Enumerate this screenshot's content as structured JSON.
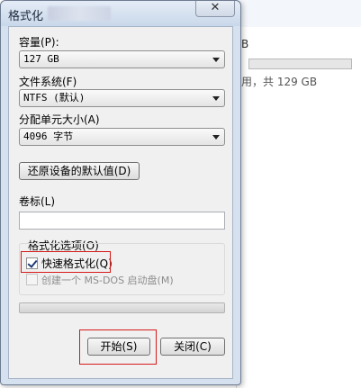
{
  "dialog": {
    "title": "格式化",
    "close_glyph": "✕"
  },
  "capacity": {
    "label": "容量(P):",
    "value": "127 GB"
  },
  "filesystem": {
    "label": "文件系统(F)",
    "value": "NTFS (默认)"
  },
  "allocation": {
    "label": "分配单元大小(A)",
    "value": "4096 字节"
  },
  "restore_defaults_label": "还原设备的默认值(D)",
  "volume": {
    "label": "卷标(L)",
    "value": ""
  },
  "format_options": {
    "label": "格式化选项(O)",
    "quick_format_label": "快速格式化(Q)",
    "quick_format_checked": true,
    "msdos_label": "创建一个 MS-DOS 启动盘(M)",
    "msdos_checked": false,
    "msdos_enabled": false
  },
  "progress": 0,
  "buttons": {
    "start": "开始(S)",
    "close": "关闭(C)"
  },
  "background": {
    "drive_fragment": "B",
    "caption": "用，共 129 GB"
  },
  "colors": {
    "highlight_box": "#d61a1a",
    "dialog_frame": "#d6e1ef"
  }
}
